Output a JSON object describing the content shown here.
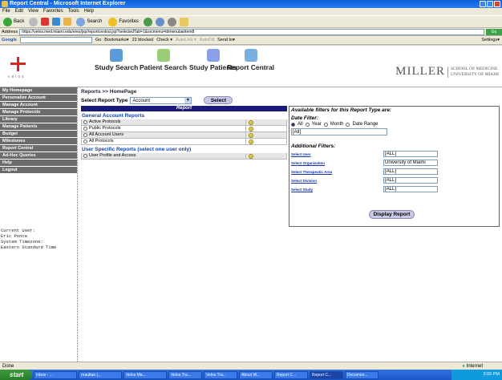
{
  "window": {
    "title": "Report Central - Microsoft Internet Explorer"
  },
  "menubar": [
    "File",
    "Edit",
    "View",
    "Favorites",
    "Tools",
    "Help"
  ],
  "toolbar": {
    "back": "Back",
    "search": "Search",
    "favorites": "Favorites"
  },
  "addressbar": {
    "label": "Address",
    "url": "https://velos.med.miami.edu/eres/jsp/reportcentral.jsp?selectedTab=1&srcmenu=tdmenubaritem8",
    "go": "Go"
  },
  "googlebar": {
    "label": "Google",
    "items": [
      "Go",
      "Bookmarks▾",
      "22 blocked",
      "Check ▾",
      "AutoLink ▾",
      "AutoFill",
      "Send to▾"
    ],
    "settings": "Settings▾"
  },
  "header": {
    "logo_text": "velos",
    "nav": [
      "Study Search",
      "Patient Search",
      "Study Patients",
      "Report Central"
    ],
    "miller": "MILLER",
    "miller_sub1": "SCHOOL OF MEDICINE",
    "miller_sub2": "UNIVERSITY OF MIAMI"
  },
  "sidebar": {
    "items": [
      "My Homepage",
      "Personalize Account",
      "Manage Account",
      "Manage Protocols",
      "Library",
      "Manage Patients",
      "Budget",
      "Milestones",
      "Report Central",
      "Ad-Hoc Queries",
      "Help",
      "Logout"
    ],
    "current_user_label": "Current User:",
    "current_user": "Eric Ponce",
    "timezone_label": "System Timezone:",
    "timezone": "Eastern Standard Time"
  },
  "main": {
    "breadcrumb": "Reports >> HomePage",
    "report_type_label": "Select Report Type",
    "report_type_value": "Account",
    "select_button": "Select",
    "report_header": "Report",
    "general_section": "General Account Reports",
    "general_reports": [
      "Active Protocols",
      "Public Protocols",
      "All Account Users",
      "All Protocols"
    ],
    "user_section": "User Specific Reports (select one user only)",
    "user_reports": [
      "User Profile and Access"
    ],
    "help_glyph": "?"
  },
  "filters": {
    "title": "Available filters for this Report Type are:",
    "date_filter_label": "Date Filter:",
    "date_options": [
      "All",
      "Year",
      "Month",
      "Date Range"
    ],
    "date_selected": "All",
    "date_value": "[All]",
    "additional_label": "Additional Filters:",
    "rows": [
      {
        "label": "Select User",
        "value": "[ALL]"
      },
      {
        "label": "Select Organization",
        "value": "University of Miami"
      },
      {
        "label": "Select Therapeutic Area",
        "value": "[ALL]"
      },
      {
        "label": "Select Division",
        "value": "[ALL]"
      },
      {
        "label": "Select Study",
        "value": "[ALL]"
      }
    ],
    "display_button": "Display Report"
  },
  "statusbar": {
    "text": "Done",
    "zone": "Internet"
  },
  "taskbar": {
    "start": "start",
    "tasks": [
      "Inbox - ...",
      "rnaultan (...",
      "Velos Ma...",
      "Velos Tra...",
      "Velos Tra...",
      "About W...",
      "Report C...",
      "Report C...",
      "Documen..."
    ],
    "active_index": 7,
    "clock": "3:55 PM"
  },
  "colors": {
    "sidebar_bg": "#6b6b6b",
    "report_header": "#1a1a7a",
    "link_blue": "#1144aa",
    "titlebar": "#0a5fd8"
  }
}
